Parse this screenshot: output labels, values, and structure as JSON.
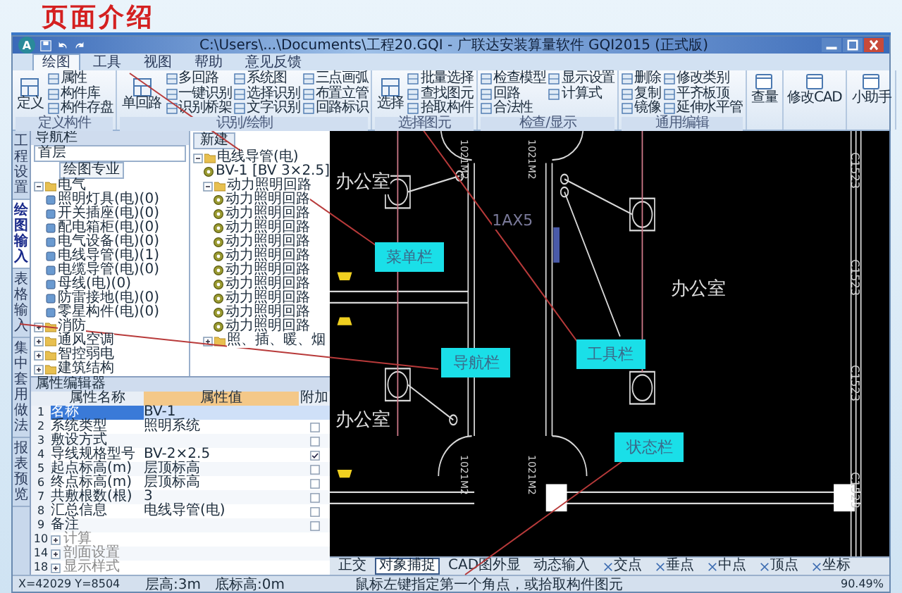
{
  "page_title": "页面介绍",
  "window": {
    "logo": "A",
    "title": "C:\\Users\\...\\Documents\\工程20.GQI - 广联达安装算量软件 GQI2015 (正式版)"
  },
  "tabs": [
    {
      "label": "绘图",
      "selected": true
    },
    {
      "label": "工具",
      "selected": false
    },
    {
      "label": "视图",
      "selected": false
    },
    {
      "label": "帮助",
      "selected": false
    },
    {
      "label": "意见反馈",
      "selected": false
    }
  ],
  "ribbon": {
    "groups": [
      {
        "label": "定义构件",
        "big": [
          "定义"
        ],
        "columns": [
          [
            "属性",
            "构件库",
            "构件存盘"
          ]
        ]
      },
      {
        "label": "识别/绘制",
        "big": [
          "单回路"
        ],
        "columns": [
          [
            "多回路",
            "一键识别",
            "识别桥架"
          ],
          [
            "系统图",
            "选择识别",
            "文字识别"
          ],
          [
            "三点画弧",
            "布置立管",
            "回路标识"
          ]
        ]
      },
      {
        "label": "选择图元",
        "big": [
          "选择"
        ],
        "columns": [
          [
            "批量选择",
            "查找图元",
            "拾取构件"
          ]
        ]
      },
      {
        "label": "检查/显示",
        "columns": [
          [
            "检查模型",
            "回路",
            "合法性"
          ],
          [
            "显示设置",
            "计算式"
          ]
        ]
      },
      {
        "label": "通用编辑",
        "columns": [
          [
            "删除",
            "复制",
            "镜像"
          ],
          [
            "修改类别",
            "平齐板顶",
            "延伸水平管"
          ]
        ]
      }
    ],
    "extra": [
      "查量",
      "修改CAD",
      "小助手"
    ]
  },
  "side_tabs": [
    {
      "label": "工程设置",
      "selected": false
    },
    {
      "label": "绘图输入",
      "selected": true
    },
    {
      "label": "表格输入",
      "selected": false
    },
    {
      "label": "集中套用做法",
      "selected": false
    },
    {
      "label": "报表预览",
      "selected": false
    }
  ],
  "nav": {
    "title": "导航栏",
    "floor": "首层",
    "filter": "绘图专业",
    "tree": [
      {
        "label": "电气",
        "expanded": true,
        "children": [
          {
            "label": "照明灯具(电)(0)"
          },
          {
            "label": "开关插座(电)(0)"
          },
          {
            "label": "配电箱柜(电)(0)"
          },
          {
            "label": "电气设备(电)(0)"
          },
          {
            "label": "电线导管(电)(1)"
          },
          {
            "label": "电缆导管(电)(0)"
          },
          {
            "label": "母线(电)(0)"
          },
          {
            "label": "防雷接地(电)(0)"
          },
          {
            "label": "零星构件(电)(0)"
          }
        ]
      },
      {
        "label": "消防",
        "expanded": false
      },
      {
        "label": "通风空调",
        "expanded": false
      },
      {
        "label": "智控弱电",
        "expanded": false
      },
      {
        "label": "建筑结构",
        "expanded": false
      }
    ]
  },
  "list": {
    "new_button": "新建",
    "tree": [
      {
        "label": "电线导管(电)",
        "expanded": true,
        "children": [
          {
            "label": "BV-1 [BV 3×2.5]"
          },
          {
            "label": "动力照明回路",
            "expanded": true,
            "children": [
              {
                "label": "动力照明回路"
              },
              {
                "label": "动力照明回路"
              },
              {
                "label": "动力照明回路"
              },
              {
                "label": "动力照明回路"
              },
              {
                "label": "动力照明回路"
              },
              {
                "label": "动力照明回路"
              },
              {
                "label": "动力照明回路"
              },
              {
                "label": "动力照明回路"
              },
              {
                "label": "动力照明回路"
              },
              {
                "label": "动力照明回路"
              }
            ]
          },
          {
            "label": "照、插、暖、烟",
            "expanded": false
          }
        ]
      }
    ]
  },
  "props": {
    "title": "属性编辑器",
    "columns": [
      "属性名称",
      "属性值",
      "附加"
    ],
    "rows": [
      {
        "kind": "property",
        "index": "1",
        "name": "名称",
        "value": "BV-1",
        "selected": true
      },
      {
        "kind": "property",
        "index": "2",
        "name": "系统类型",
        "value": "照明系统",
        "selected": false,
        "checked": false
      },
      {
        "kind": "property",
        "index": "3",
        "name": "敷设方式",
        "selected": false,
        "checked": false
      },
      {
        "kind": "property",
        "index": "4",
        "name": "导线规格型号",
        "value": "BV-2×2.5",
        "selected": false,
        "checked": true
      },
      {
        "kind": "property",
        "index": "5",
        "name": "起点标高(m)",
        "value": "层顶标高",
        "selected": false,
        "checked": false
      },
      {
        "kind": "property",
        "index": "6",
        "name": "终点标高(m)",
        "value": "层顶标高",
        "selected": false,
        "checked": false
      },
      {
        "kind": "property",
        "index": "7",
        "name": "共敷根数(根)",
        "value": "3",
        "selected": false,
        "checked": false
      },
      {
        "kind": "property",
        "index": "8",
        "name": "汇总信息",
        "value": "电线导管(电)",
        "selected": false,
        "checked": false
      },
      {
        "kind": "property",
        "index": "9",
        "name": "备注",
        "selected": false,
        "checked": false
      },
      {
        "kind": "group",
        "index": "10",
        "name": "计算",
        "selected": false,
        "expanded": false
      },
      {
        "kind": "group",
        "index": "14",
        "name": "剖面设置",
        "selected": false,
        "expanded": false
      },
      {
        "kind": "group",
        "index": "18",
        "name": "显示样式",
        "selected": false,
        "expanded": false
      }
    ]
  },
  "canvas": {
    "rooms": [
      "办公室",
      "办公室",
      "办公室"
    ],
    "box_label": "1AX5",
    "doors": [
      "1021M2",
      "1021M2",
      "1021M2",
      "1021M2"
    ],
    "windows": [
      "C1523",
      "C1523",
      "C1523",
      "C1523"
    ],
    "callouts": [
      "菜单栏",
      "导航栏",
      "工具栏",
      "状态栏"
    ]
  },
  "snap_bar": [
    {
      "kind": "toggle",
      "label": "正交",
      "selected": false
    },
    {
      "kind": "toggle",
      "label": "对象捕捉",
      "selected": true
    },
    {
      "kind": "toggle",
      "label": "CAD图外显",
      "selected": false
    },
    {
      "kind": "toggle",
      "label": "动态输入",
      "selected": false
    },
    {
      "kind": "snap",
      "label": "交点",
      "selected": false
    },
    {
      "kind": "snap",
      "label": "垂点",
      "selected": false
    },
    {
      "kind": "snap",
      "label": "中点",
      "selected": false
    },
    {
      "kind": "snap",
      "label": "顶点",
      "selected": false
    },
    {
      "kind": "snap",
      "label": "坐标",
      "selected": false
    }
  ],
  "status": {
    "coords": "X=42029 Y=8504",
    "floor_height": "层高:3m",
    "base_elevation": "底标高:0m",
    "hint": "鼠标左键指定第一个角点，或拾取构件图元",
    "zoom": "90.49%"
  }
}
